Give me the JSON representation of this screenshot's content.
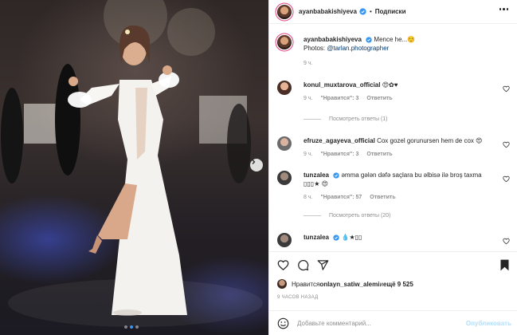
{
  "post": {
    "carousel": {
      "slide_count": 3,
      "active_slide": 1
    }
  },
  "header": {
    "username": "ayanbabakishiyeva",
    "separator": "•",
    "follow_label": "Подписки"
  },
  "caption": {
    "username": "ayanbabakishiyeva",
    "text": "Mence he...☺️",
    "photos_prefix": "Photos: ",
    "photos_link": "@tarlan.photographer",
    "time": "9 ч."
  },
  "comments": [
    {
      "username": "konul_muxtarova_official",
      "text": "😍✿♥",
      "time": "9 ч.",
      "likes": "\"Нравится\": 3",
      "reply_label": "Ответить",
      "replies_label": "Посмотреть ответы (1)",
      "verified": false
    },
    {
      "username": "efruze_agayeva_official",
      "text": "Cox gozel gorunursen hem de cox 😍",
      "time": "9 ч.",
      "likes": "\"Нравится\": 3",
      "reply_label": "Ответить",
      "verified": false
    },
    {
      "username": "tunzalea",
      "text": "əmma gələn dəfə saçlara bu əlbisə ilə broş taxma ▯▯▯★ 😍",
      "time": "8 ч.",
      "likes": "\"Нравится\": 57",
      "reply_label": "Ответить",
      "replies_label": "Посмотреть ответы (20)",
      "verified": true
    },
    {
      "username": "tunzalea",
      "text": "💧★▯▯",
      "verified": true
    }
  ],
  "likes": {
    "prefix": "Нравится ",
    "user": "onlayn_satiw_alemi",
    "middle": " и ",
    "count": "ещё 9 525"
  },
  "posted_time": "9 ЧАСОВ НАЗАД",
  "add_comment": {
    "placeholder": "Добавьте комментарий...",
    "publish_label": "Опубликовать"
  },
  "icons": {
    "like": "heart-icon",
    "comment": "comment-icon",
    "share": "paper-plane-icon",
    "save": "bookmark-icon",
    "emoji": "smiley-icon",
    "more": "more-dots-icon",
    "next": "chevron-right-icon",
    "verified": "verified-badge-icon"
  },
  "colors": {
    "verified": "#3897f0",
    "link": "#00376b",
    "muted": "#8e8e8e",
    "publish": "#b2dffc",
    "story_ring": "#e4407f"
  }
}
